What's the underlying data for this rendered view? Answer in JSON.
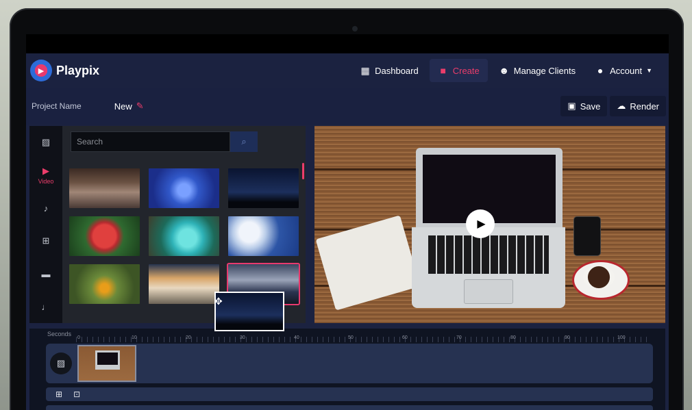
{
  "brand": {
    "name": "Playpix"
  },
  "nav": {
    "dashboard": "Dashboard",
    "create": "Create",
    "manage_clients": "Manage Clients",
    "account": "Account"
  },
  "project": {
    "label": "Project Name",
    "name": "New",
    "save": "Save",
    "render": "Render"
  },
  "sidebar": {
    "video_label": "Video"
  },
  "library": {
    "search_placeholder": "Search"
  },
  "timeline": {
    "label": "Seconds",
    "ticks": [
      "0",
      "10",
      "20",
      "30",
      "40",
      "50",
      "60",
      "70",
      "80",
      "90",
      "100"
    ]
  },
  "colors": {
    "accent": "#ec3d6b",
    "navbar": "#1b2240",
    "track": "#263251"
  }
}
